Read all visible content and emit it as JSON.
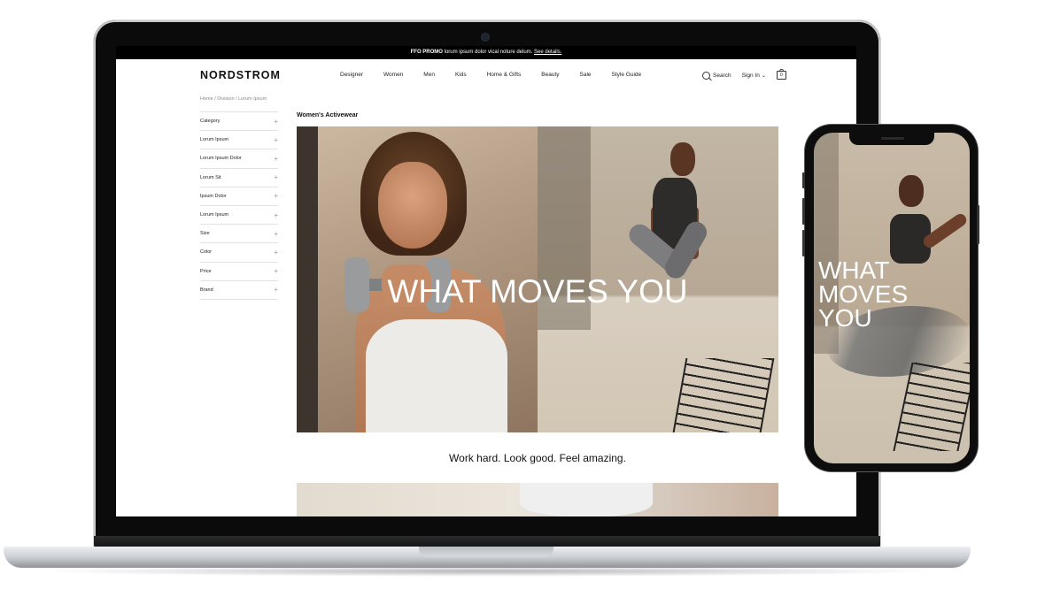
{
  "promo": {
    "label": "FFO PROMO",
    "text": " lorum ipsum dolor vical noture delum. ",
    "link": "See details."
  },
  "header": {
    "logo": "NORDSTROM",
    "nav": [
      "Designer",
      "Women",
      "Men",
      "Kids",
      "Home & Gifts",
      "Beauty",
      "Sale",
      "Style Guide"
    ],
    "search_label": "Search",
    "signin_label": "Sign In",
    "bag_count": "0"
  },
  "breadcrumb": "Home /  Division  /  Lorum Ipsum",
  "sidebar": {
    "filters": [
      "Category",
      "Lorum Ipsum",
      "Lorum Ipsum Dolor",
      "Lorum Sit",
      "Ipsum Dolor",
      "Lorum Ipsum",
      "Size",
      "Color",
      "Price",
      "Brand"
    ]
  },
  "main": {
    "title": "Women's Activewear",
    "hero_headline": "WHAT MOVES YOU",
    "tagline": "Work hard. Look good. Feel amazing."
  },
  "phone": {
    "headline_lines": [
      "WHAT",
      "MOVES",
      "YOU"
    ]
  },
  "colors": {
    "background": "#ffffff",
    "promo_bar": "#000000",
    "text": "#111111"
  }
}
